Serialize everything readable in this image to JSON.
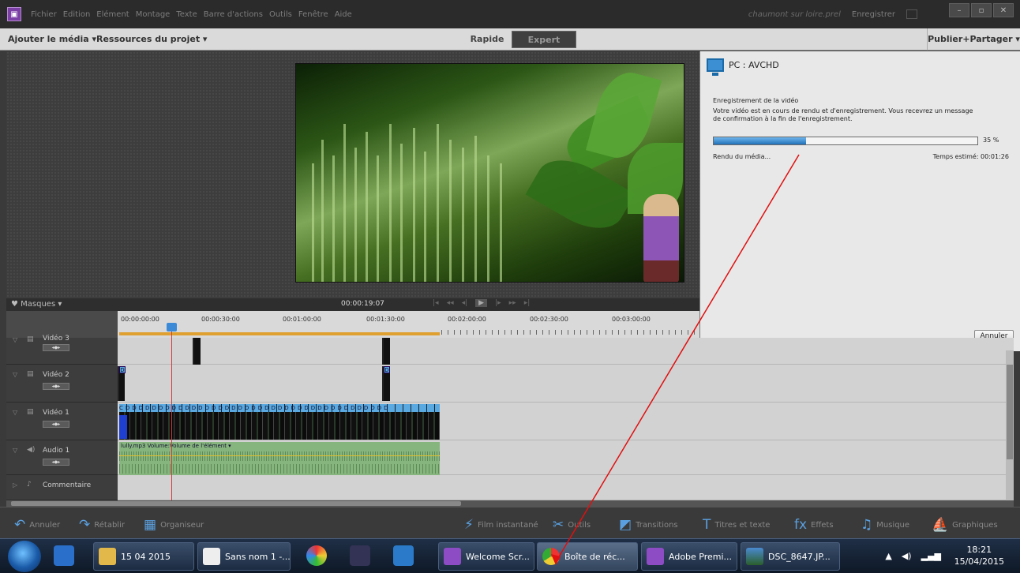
{
  "title_bar": {
    "menu": [
      "Fichier",
      "Edition",
      "Elément",
      "Montage",
      "Texte",
      "Barre d'actions",
      "Outils",
      "Fenêtre",
      "Aide"
    ],
    "project_name": "chaumont sur loire.prel",
    "save_label": "Enregistrer",
    "window_controls": [
      "–",
      "▫",
      "✕"
    ]
  },
  "toolbar": {
    "add_media": "Ajouter le média ▾",
    "project_assets": "Ressources du projet ▾",
    "mode_quick": "Rapide",
    "mode_expert": "Expert",
    "publish": "Publier+Partager ▾"
  },
  "monitor": {
    "markers": "♥ Masques ▾",
    "timecode": "00:00:19:07"
  },
  "ruler": {
    "ticks": [
      "00:00:00:00",
      "00:00:30:00",
      "00:01:00:00",
      "00:01:30:00",
      "00:02:00:00",
      "00:02:30:00",
      "00:03:00:00"
    ]
  },
  "export_panel": {
    "title": "PC : AVCHD",
    "heading": "Enregistrement de la vidéo",
    "message": "Votre vidéo est en cours de rendu et d'enregistrement. Vous recevrez un message de confirmation à la fin de l'enregistrement.",
    "progress_percent": 35,
    "progress_label": "35 %",
    "status": "Rendu du média...",
    "eta": "Temps estimé: 00:01:26",
    "cancel": "Annuler"
  },
  "tracks": [
    {
      "name": "Vidéo 3",
      "type": "video"
    },
    {
      "name": "Vidéo 2",
      "type": "video"
    },
    {
      "name": "Vidéo 1",
      "type": "video"
    },
    {
      "name": "Audio 1",
      "type": "audio",
      "clip_label": "lully.mp3 Volume:Volume de l'élément ▾"
    },
    {
      "name": "Commentaire",
      "type": "voice"
    }
  ],
  "bottom_bar": {
    "undo": "Annuler",
    "redo": "Rétablir",
    "organizer": "Organiseur",
    "instant_movie": "Film instantané",
    "tools": "Outils",
    "transitions": "Transitions",
    "titles": "Titres et texte",
    "effects": "Effets",
    "music": "Musique",
    "graphics": "Graphiques"
  },
  "taskbar": {
    "items": [
      "15 04 2015",
      "Sans nom 1 -...",
      "Welcome Scr...",
      "Boîte de réc...",
      "Adobe Premi...",
      "DSC_8647.JP..."
    ],
    "time": "18:21",
    "date": "15/04/2015"
  },
  "colors": {
    "accent": "#2170b8",
    "playhead": "#d43a3a",
    "annotation": "#e01010"
  }
}
